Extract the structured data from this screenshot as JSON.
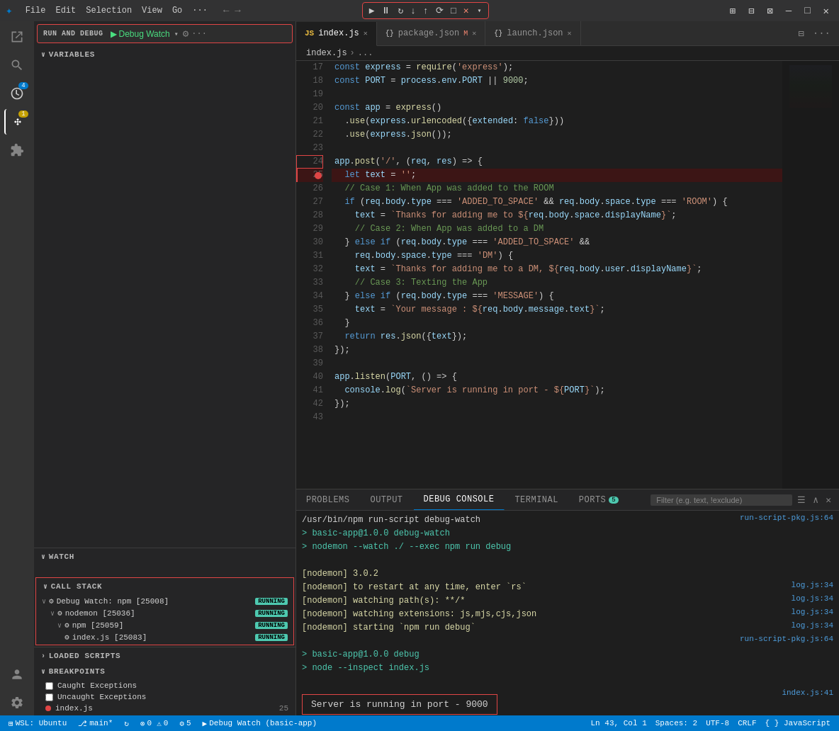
{
  "titlebar": {
    "logo": "✦",
    "menus": [
      "File",
      "Edit",
      "Selection",
      "View",
      "Go",
      "···"
    ],
    "nav_back": "←",
    "nav_forward": "→",
    "debug_toolbar": {
      "continue": "▶",
      "pause": "⏸",
      "step_over": "↻",
      "step_into": "↓",
      "step_out": "↑",
      "restart": "⟳",
      "stop": "□",
      "close": "✕"
    },
    "window_controls": {
      "layout": "⊞",
      "split": "⊟",
      "panels": "⊠",
      "minimize": "—",
      "maximize": "□",
      "close": "✕"
    }
  },
  "debug_panel": {
    "run_label": "RUN AND DEBUG",
    "run_config": "Debug Watch",
    "settings_label": "⚙",
    "more_label": "···"
  },
  "sections": {
    "variables": "VARIABLES",
    "watch": "WATCH",
    "callstack": "CALL STACK",
    "loaded_scripts": "LOADED SCRIPTS",
    "breakpoints": "BREAKPOINTS"
  },
  "callstack": {
    "items": [
      {
        "level": 1,
        "label": "Debug Watch: npm [25008]",
        "status": "RUNNING",
        "icon": "⚙"
      },
      {
        "level": 2,
        "label": "nodemon [25036]",
        "status": "RUNNING",
        "icon": "⚙"
      },
      {
        "level": 3,
        "label": "npm [25059]",
        "status": "RUNNING",
        "icon": "⚙"
      },
      {
        "level": 4,
        "label": "index.js [25083]",
        "status": "RUNNING",
        "icon": "⚙"
      }
    ]
  },
  "breakpoints": {
    "items": [
      {
        "type": "checkbox",
        "label": "Caught Exceptions",
        "checked": false
      },
      {
        "type": "checkbox",
        "label": "Uncaught Exceptions",
        "checked": false
      },
      {
        "type": "dot",
        "label": "index.js",
        "line": "25"
      }
    ]
  },
  "editor": {
    "tabs": [
      {
        "name": "index.js",
        "icon": "JS",
        "active": true,
        "modified": false
      },
      {
        "name": "package.json",
        "icon": "{}",
        "active": false,
        "modified": true,
        "flag": "M"
      },
      {
        "name": "launch.json",
        "icon": "{}",
        "active": false,
        "modified": false
      }
    ],
    "breadcrumb": [
      "index.js",
      "›",
      "..."
    ],
    "lines": [
      {
        "num": 17,
        "content": "const express = require('express');"
      },
      {
        "num": 18,
        "content": "const PORT = process.env.PORT || 9000;"
      },
      {
        "num": 19,
        "content": ""
      },
      {
        "num": 20,
        "content": "const app = express()"
      },
      {
        "num": 21,
        "content": "  .use(express.urlencoded({extended: false}))"
      },
      {
        "num": 22,
        "content": "  .use(express.json());"
      },
      {
        "num": 23,
        "content": ""
      },
      {
        "num": 24,
        "content": "app.post('/', (req, res) => {",
        "highlight": false
      },
      {
        "num": 25,
        "content": "  let text = '';",
        "breakpoint": true,
        "highlight": true
      },
      {
        "num": 26,
        "content": "  // Case 1: When App was added to the ROOM"
      },
      {
        "num": 27,
        "content": "  if (req.body.type === 'ADDED_TO_SPACE' && req.body.space.type === 'ROOM') {"
      },
      {
        "num": 28,
        "content": "    text = `Thanks for adding me to ${req.body.space.displayName}`;"
      },
      {
        "num": 29,
        "content": "    // Case 2: When App was added to a DM"
      },
      {
        "num": 30,
        "content": "  } else if (req.body.type === 'ADDED_TO_SPACE' &&"
      },
      {
        "num": 31,
        "content": "    req.body.space.type === 'DM') {"
      },
      {
        "num": 32,
        "content": "    text = `Thanks for adding me to a DM, ${req.body.user.displayName}`;"
      },
      {
        "num": 33,
        "content": "    // Case 3: Texting the App"
      },
      {
        "num": 34,
        "content": "  } else if (req.body.type === 'MESSAGE') {"
      },
      {
        "num": 35,
        "content": "    text = `Your message : ${req.body.message.text}`;"
      },
      {
        "num": 36,
        "content": "  }"
      },
      {
        "num": 37,
        "content": "  return res.json({text});"
      },
      {
        "num": 38,
        "content": "});"
      },
      {
        "num": 39,
        "content": ""
      },
      {
        "num": 40,
        "content": "app.listen(PORT, () => {"
      },
      {
        "num": 41,
        "content": "  console.log(`Server is running in port - ${PORT}`);"
      },
      {
        "num": 42,
        "content": "});"
      },
      {
        "num": 43,
        "content": ""
      }
    ]
  },
  "panel": {
    "tabs": [
      "PROBLEMS",
      "OUTPUT",
      "DEBUG CONSOLE",
      "TERMINAL",
      "PORTS"
    ],
    "ports_count": "5",
    "active_tab": "DEBUG CONSOLE",
    "filter_placeholder": "Filter (e.g. text, !exclude)",
    "console_lines": [
      {
        "text": "/usr/bin/npm run-script debug-watch",
        "color": "white"
      },
      {
        "text": "",
        "color": "white",
        "link": "run-script-pkg.js:64"
      },
      {
        "text": "> basic-app@1.0.0 debug-watch",
        "color": "green"
      },
      {
        "text": "> nodemon --watch ./ --exec npm run debug",
        "color": "green"
      },
      {
        "text": "",
        "color": "white"
      },
      {
        "text": "[nodemon] 3.0.2",
        "color": "yellow"
      },
      {
        "text": "[nodemon] to restart at any time, enter `rs`",
        "color": "yellow",
        "link": "log.js:34"
      },
      {
        "text": "[nodemon] watching path(s): **/*",
        "color": "yellow",
        "link": "log.js:34"
      },
      {
        "text": "[nodemon] watching extensions: js,mjs,cjs,json",
        "color": "yellow",
        "link": "log.js:34"
      },
      {
        "text": "[nodemon] starting `npm run debug`",
        "color": "yellow",
        "link": "log.js:34"
      },
      {
        "text": "",
        "color": "white",
        "link": "run-script-pkg.js:64"
      },
      {
        "text": "> basic-app@1.0.0 debug",
        "color": "green"
      },
      {
        "text": "> node --inspect index.js",
        "color": "green"
      },
      {
        "text": "",
        "color": "white"
      },
      {
        "text": "Server is running in port - 9000",
        "color": "white",
        "box": true,
        "link": "index.js:41"
      }
    ]
  },
  "statusbar": {
    "wsl": "WSL: Ubuntu",
    "git_branch": "main*",
    "sync": "↻",
    "errors": "0",
    "warnings": "0",
    "debug_sessions": "5",
    "debug_config": "Debug Watch (basic-app)",
    "position": "Ln 43, Col 1",
    "spaces": "Spaces: 2",
    "encoding": "UTF-8",
    "line_ending": "CRLF",
    "language": "{ } JavaScript"
  }
}
